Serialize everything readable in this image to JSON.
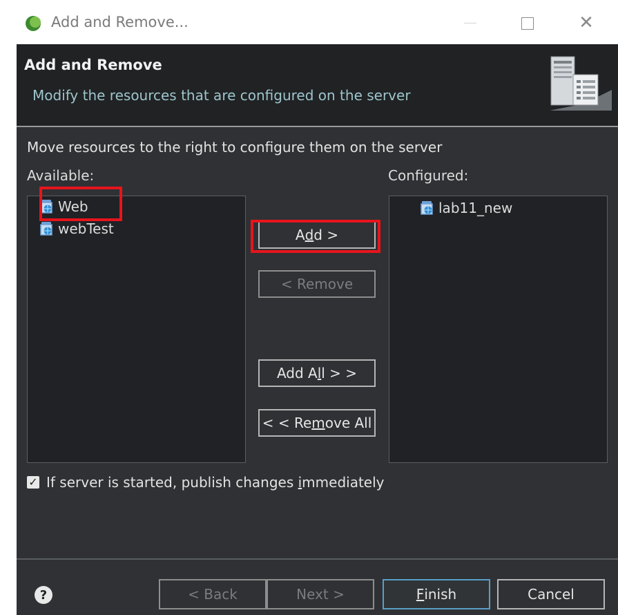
{
  "window": {
    "title": "Add and Remove..."
  },
  "header": {
    "title": "Add and Remove",
    "description": "Modify the resources that are configured on the server"
  },
  "instructions": "Move resources to the right to configure them on the server",
  "available": {
    "label": "Available:",
    "items": [
      {
        "label": "Web",
        "icon": "web-project-icon",
        "highlighted": true
      },
      {
        "label": "webTest",
        "icon": "web-project-icon"
      }
    ]
  },
  "configured": {
    "label": "Configured:",
    "items": [
      {
        "label": "lab11_new",
        "icon": "web-project-icon"
      }
    ]
  },
  "buttons": {
    "add": {
      "pre": "A",
      "mnemonic": "d",
      "post": "d >"
    },
    "remove": "< Remove",
    "add_all": {
      "pre": "Add A",
      "mnemonic": "l",
      "post": "l > >"
    },
    "remove_all": {
      "pre": "< < Re",
      "mnemonic": "m",
      "post": "ove All"
    }
  },
  "publish_checkbox": {
    "checked": true,
    "label_pre": "If server is started, publish changes ",
    "label_mnemonic": "i",
    "label_post": "mmediately"
  },
  "footer": {
    "back": "< Back",
    "next": "Next >",
    "finish": {
      "mnemonic": "F",
      "post": "inish"
    },
    "cancel": "Cancel"
  },
  "colors": {
    "highlight": "#e8141c",
    "dialog_bg": "#2f3134",
    "header_bg": "#202224"
  }
}
